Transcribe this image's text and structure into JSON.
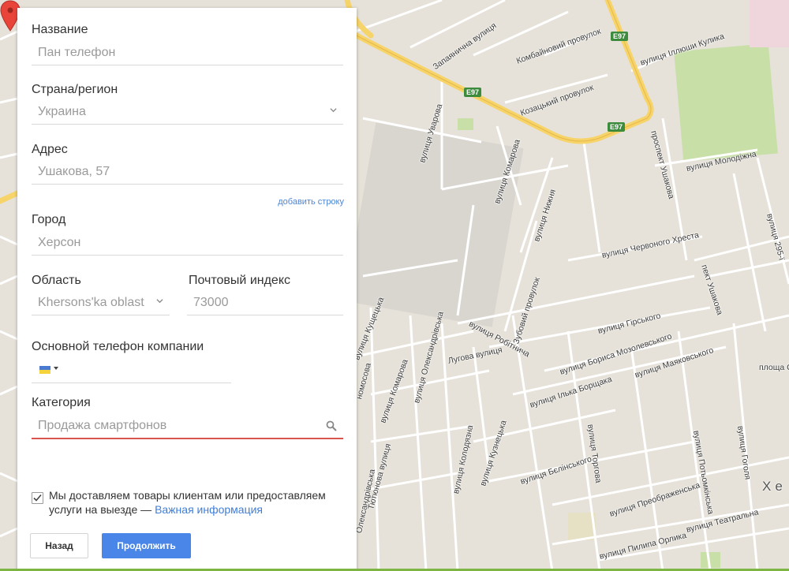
{
  "form": {
    "name": {
      "label": "Название",
      "placeholder": "Пан телефон"
    },
    "country": {
      "label": "Страна/регион",
      "value": "Украина"
    },
    "address": {
      "label": "Адрес",
      "value": "Ушакова, 57",
      "add_line": "добавить строку"
    },
    "city": {
      "label": "Город",
      "value": "Херсон"
    },
    "region": {
      "label": "Область",
      "value": "Khersons'ka oblast"
    },
    "postal": {
      "label": "Почтовый индекс",
      "value": "73000"
    },
    "phone": {
      "label": "Основной телефон компании",
      "flag": "ukraine-flag-icon"
    },
    "category": {
      "label": "Категория",
      "value": "Продажа смартфонов",
      "icon": "search-icon"
    },
    "delivery": {
      "checked": true,
      "text": "Мы доставляем товары клиентам или предоставляем услуги на выезде —",
      "link": "Важная информация"
    },
    "back_button": "Назад",
    "continue_button": "Продолжить"
  },
  "map": {
    "streets": [
      "вулиця Уварова",
      "Запаянична вулиця",
      "Комбайновий провулок",
      "вулиця Іллюши Кулика",
      "Козацький провулок",
      "проспект Ушакова",
      "вулиця Молодіжна",
      "вулиця Комарова",
      "вулиця Нижня",
      "вулиця Червоного Хреста",
      "пект Ушакова",
      "вулиця 295-ї",
      "вулиця Робітнича",
      "Зубовий провулок",
      "вулиця Гірського",
      "вулиця Бориса Мозолевського",
      "вулиця Маяковського",
      "вулиця Ількa Борщака",
      "вулиця Олександрівська",
      "Лугова вулиця",
      "вулиця Кущецька",
      "вулиця Кузнецька",
      "вулиця Колодязна",
      "вулиця Бєлінського",
      "вулиця Торгова",
      "вулиця Потьомкінська",
      "вулиця Гоголя",
      "вулиця Преображенська",
      "вулиця Пилипа Орлика",
      "вулиця Театральна",
      "площа С",
      "Тютюнова вулиця",
      "Олександрівська",
      "вулиця Комарова",
      "номосова"
    ],
    "route_shield": "E97",
    "city_fragment": "Хе",
    "pin_icon": "map-pin-icon"
  }
}
